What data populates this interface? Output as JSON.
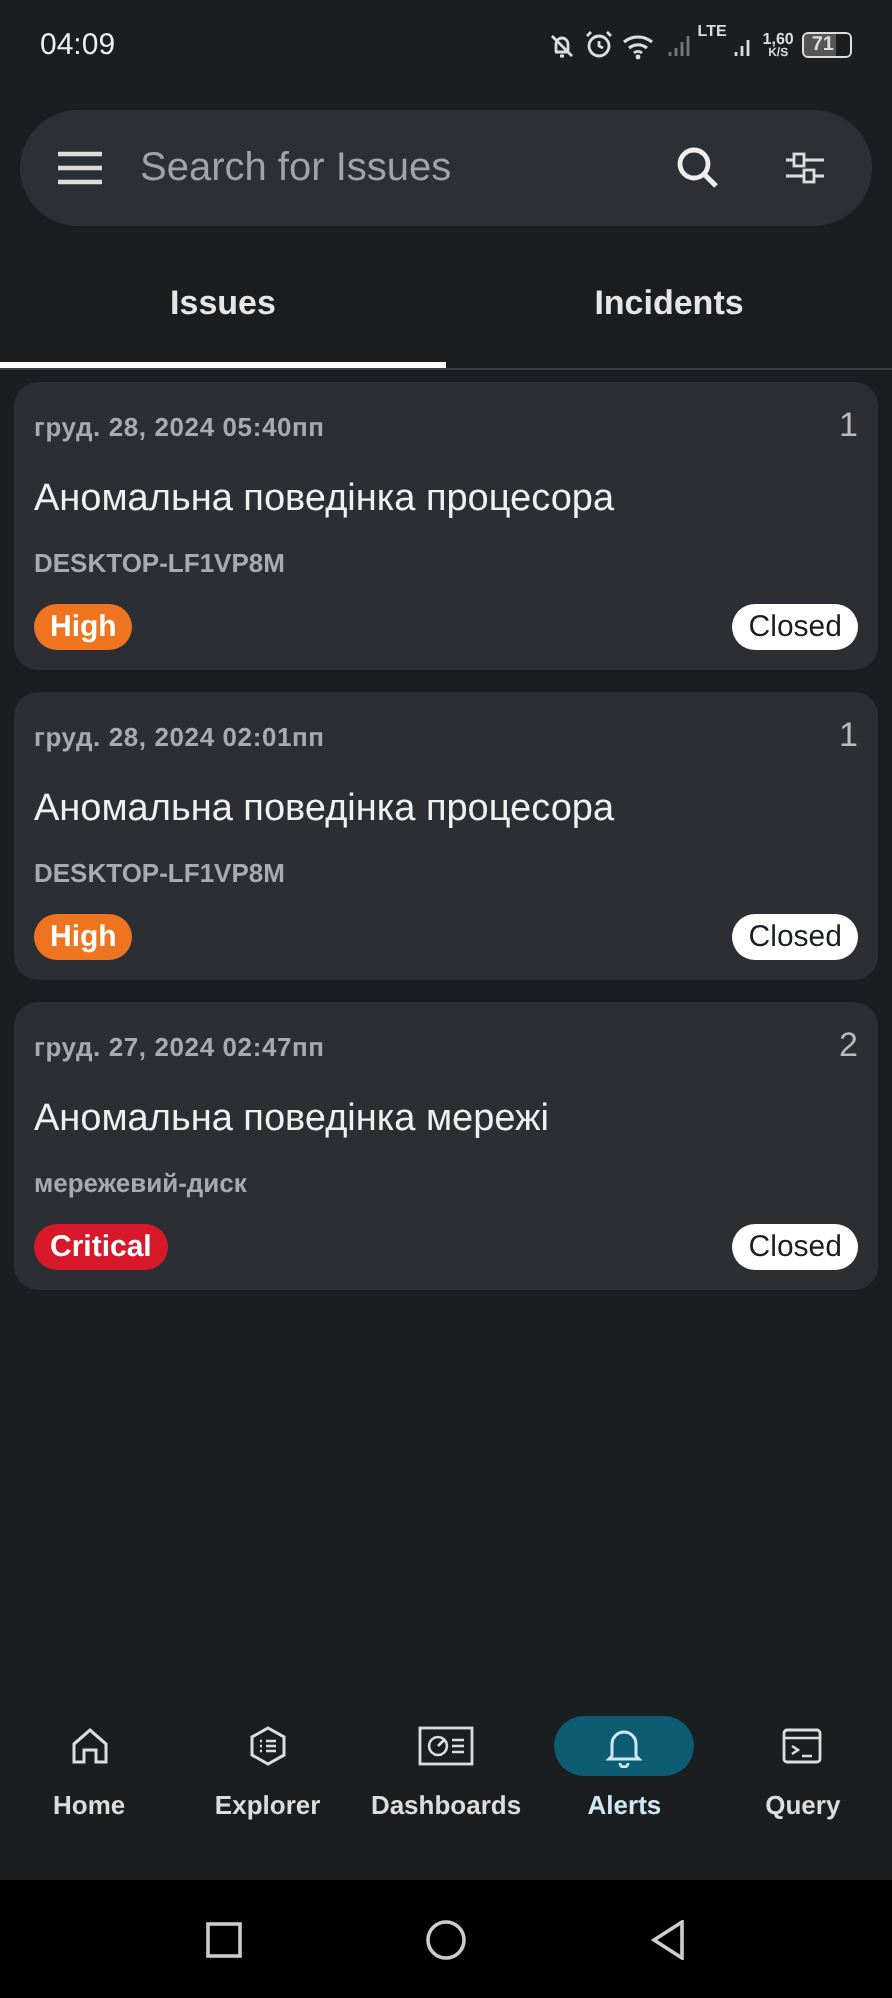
{
  "status_bar": {
    "time": "04:09",
    "network": "LTE",
    "speed": "1,60",
    "speed_unit": "K/S",
    "battery": "71"
  },
  "search": {
    "placeholder": "Search for Issues"
  },
  "tabs": [
    {
      "label": "Issues",
      "selected": true
    },
    {
      "label": "Incidents",
      "selected": false
    }
  ],
  "issues": [
    {
      "date": "груд. 28, 2024 05:40пп",
      "count": "1",
      "title": "Аномальна поведінка процесора",
      "host": "DESKTOP-LF1VP8M",
      "severity": "High",
      "color": "#ee7420",
      "status": "Closed"
    },
    {
      "date": "груд. 28, 2024 02:01пп",
      "count": "1",
      "title": "Аномальна поведінка процесора",
      "host": "DESKTOP-LF1VP8M",
      "severity": "High",
      "color": "#ee7420",
      "status": "Closed"
    },
    {
      "date": "груд. 27, 2024 02:47пп",
      "count": "2",
      "title": "Аномальна поведінка мережі",
      "host": "мережевий-диск",
      "severity": "Critical",
      "color": "#d7192a",
      "status": "Closed"
    }
  ],
  "bottom_nav": [
    {
      "kind": "home",
      "label": "Home",
      "selected": false
    },
    {
      "kind": "explorer",
      "label": "Explorer",
      "selected": false
    },
    {
      "kind": "dashboards",
      "label": "Dashboards",
      "selected": false
    },
    {
      "kind": "alerts",
      "label": "Alerts",
      "selected": true
    },
    {
      "kind": "query",
      "label": "Query",
      "selected": false
    }
  ]
}
